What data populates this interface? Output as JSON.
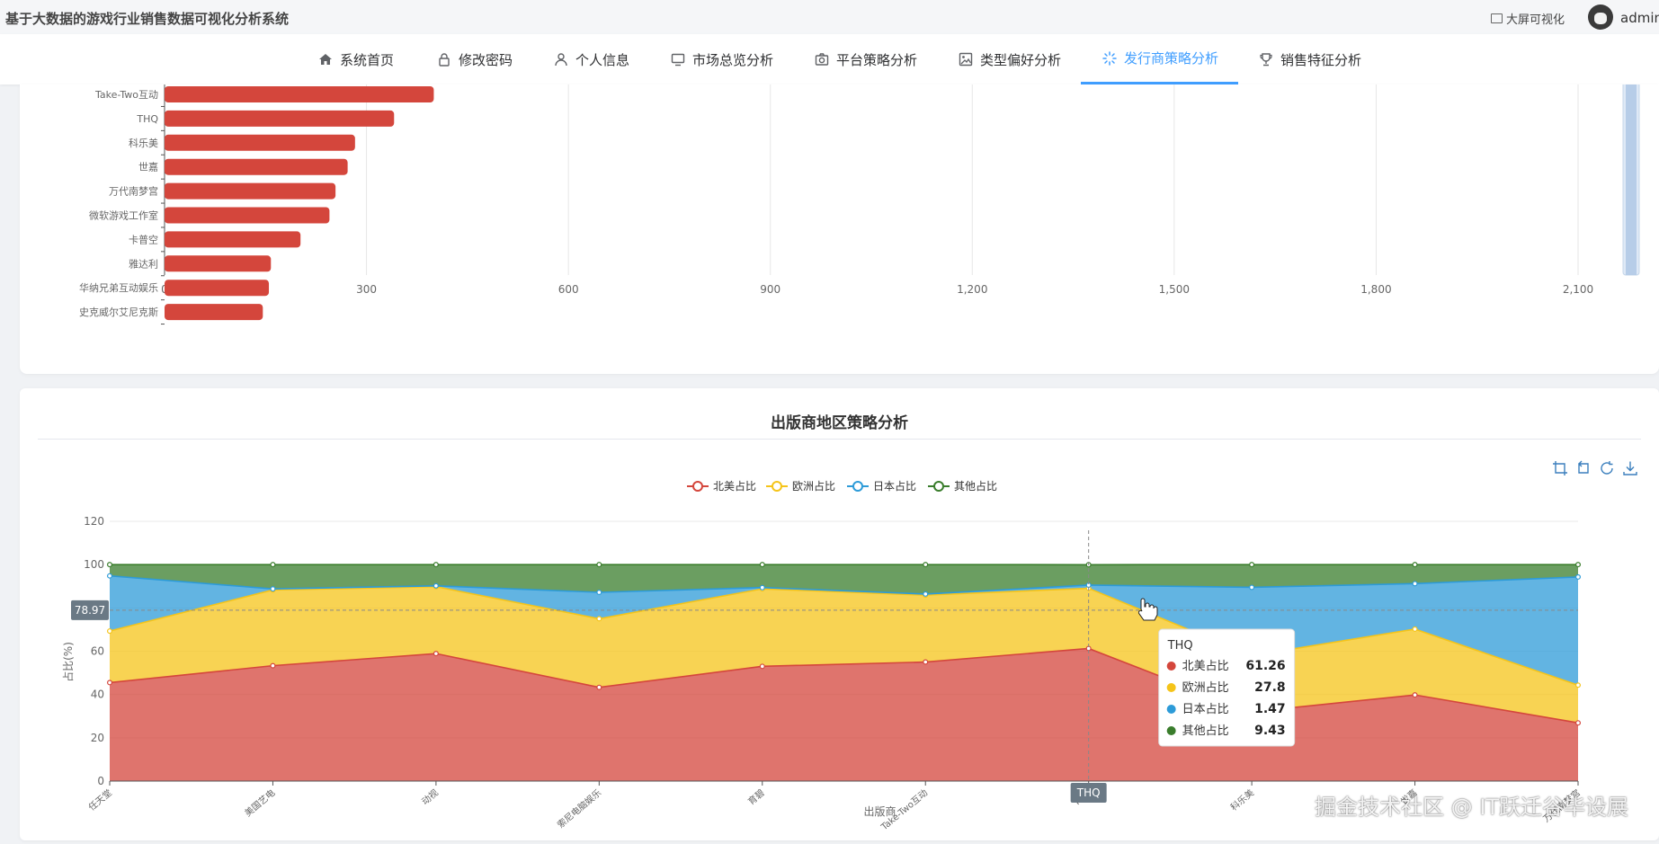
{
  "app": {
    "title": "基于大数据的游戏行业销售数据可视化分析系统"
  },
  "header": {
    "bigscreen_label": "大屏可视化",
    "user_name": "admin"
  },
  "nav": [
    {
      "label": "系统首页",
      "icon": "home-icon"
    },
    {
      "label": "修改密码",
      "icon": "lock-icon"
    },
    {
      "label": "个人信息",
      "icon": "user-icon"
    },
    {
      "label": "市场总览分析",
      "icon": "monitor-icon"
    },
    {
      "label": "平台策略分析",
      "icon": "camera-icon"
    },
    {
      "label": "类型偏好分析",
      "icon": "picture-icon"
    },
    {
      "label": "发行商策略分析",
      "icon": "loading-icon",
      "active": true
    },
    {
      "label": "销售特征分析",
      "icon": "trophy-icon"
    }
  ],
  "chart_data": [
    {
      "type": "bar",
      "orientation": "horizontal",
      "categories": [
        "Take-Two互动",
        "THQ",
        "科乐美",
        "世嘉",
        "万代南梦宫",
        "微软游戏工作室",
        "卡普空",
        "雅达利",
        "华纳兄弟互动娱乐",
        "史克威尔艾尼克斯"
      ],
      "values": [
        400,
        341,
        283,
        272,
        254,
        245,
        202,
        158,
        155,
        146
      ],
      "xlim": [
        0,
        2100
      ],
      "xticks": [
        "0",
        "300",
        "600",
        "900",
        "1,200",
        "1,500",
        "1,800",
        "2,100"
      ],
      "color": "#d4463c",
      "grid": true
    },
    {
      "type": "area",
      "stacked": true,
      "title": "出版商地区策略分析",
      "xlabel": "出版商",
      "ylabel": "占比(%)",
      "ylim": [
        0,
        120
      ],
      "yticks": [
        "0",
        "20",
        "40",
        "60",
        "80",
        "100",
        "120"
      ],
      "categories": [
        "任天堂",
        "美国艺电",
        "动视",
        "索尼电脑娱乐",
        "育碧",
        "Take-Two互动",
        "THQ",
        "科乐美",
        "世嘉",
        "万代南梦宫"
      ],
      "series": [
        {
          "name": "北美占比",
          "color": "#d4463c",
          "values": [
            45.5,
            53.3,
            58.9,
            43.3,
            53,
            55,
            61.26,
            32,
            39.8,
            26.9
          ]
        },
        {
          "name": "欧洲占比",
          "color": "#f5c419",
          "values": [
            23.8,
            35,
            30.9,
            31.7,
            35.8,
            30.9,
            27.8,
            26,
            30.4,
            17.4
          ]
        },
        {
          "name": "日本占比",
          "color": "#2d9bd8",
          "values": [
            25.5,
            0.5,
            0.4,
            12.2,
            0.6,
            0.5,
            1.47,
            31.5,
            21,
            50
          ]
        },
        {
          "name": "其他占比",
          "color": "#3a7d2c",
          "values": [
            5.2,
            11.2,
            9.8,
            12.8,
            10.6,
            13.6,
            9.43,
            10.5,
            8.8,
            5.7
          ]
        }
      ],
      "legend_position": "top-center",
      "crosshair": {
        "category": "THQ",
        "y_value": "78.97"
      },
      "tooltip": {
        "title": "THQ",
        "rows": [
          {
            "label": "北美占比",
            "value": "61.26",
            "color": "#d4463c"
          },
          {
            "label": "欧洲占比",
            "value": "27.8",
            "color": "#f5c419"
          },
          {
            "label": "日本占比",
            "value": "1.47",
            "color": "#2d9bd8"
          },
          {
            "label": "其他占比",
            "value": "9.43",
            "color": "#3a7d2c"
          }
        ]
      },
      "toolbox": [
        "zoom-icon",
        "zoom-reset-icon",
        "restore-icon",
        "download-icon"
      ]
    }
  ],
  "watermark": "掘金技术社区 @ IT跃迁谷毕设展"
}
